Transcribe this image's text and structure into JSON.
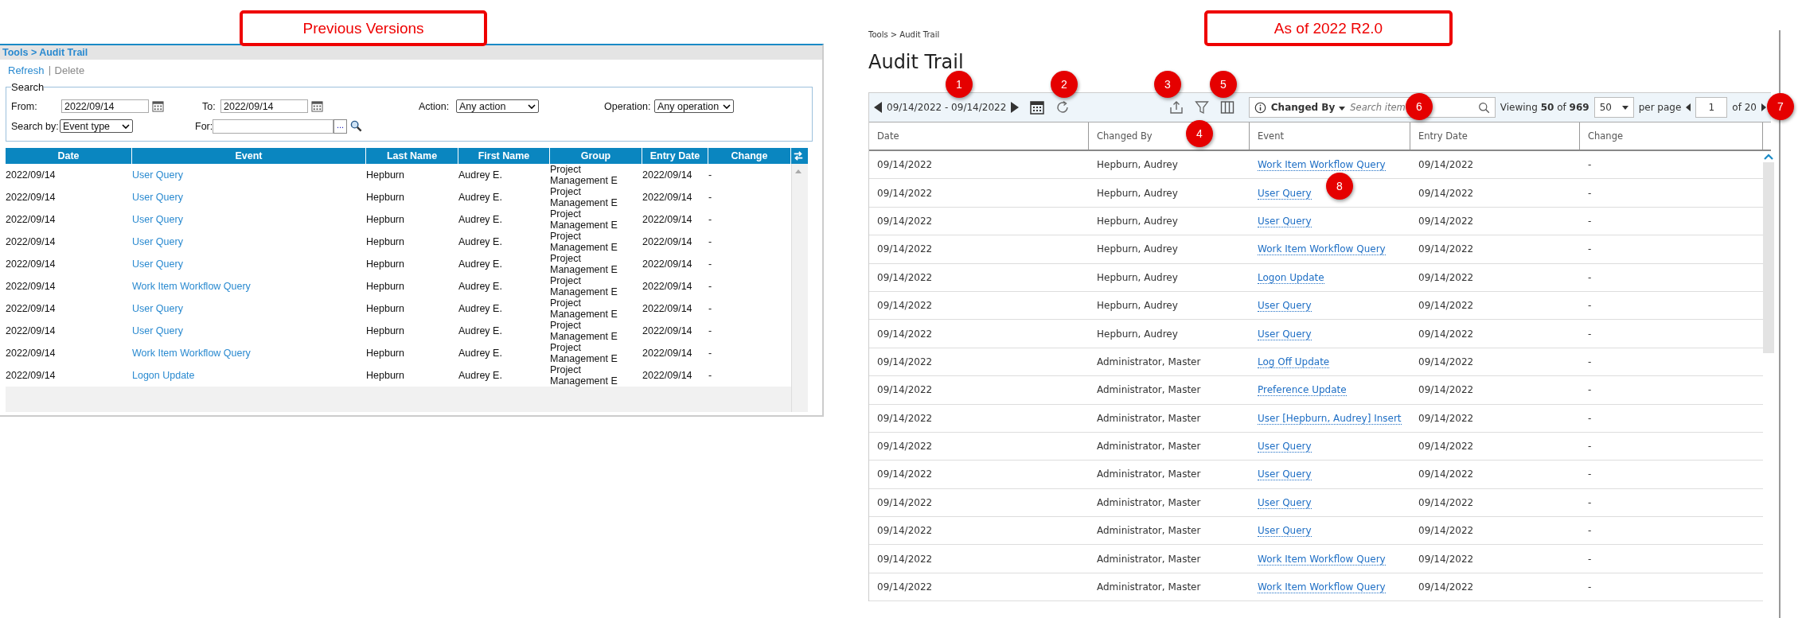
{
  "annotations": [
    {
      "text": "Previous Versions"
    },
    {
      "text": "As of 2022 R2.0"
    }
  ],
  "previous": {
    "breadcrumb": "Tools > Audit Trail",
    "actions": [
      {
        "label": "Refresh",
        "disabled": false
      },
      {
        "label": "Delete",
        "disabled": true
      }
    ],
    "search": {
      "legend": "Search",
      "from_label": "From:",
      "from_value": "2022/09/14",
      "to_label": "To:",
      "to_value": "2022/09/14",
      "action_label": "Action:",
      "action_value": "Any action",
      "operation_label": "Operation:",
      "operation_value": "Any operation",
      "search_by_label": "Search by:",
      "search_by_value": "Event type",
      "for_label": "For:",
      "browse_button": "..."
    },
    "table": {
      "columns": [
        "Date",
        "Event",
        "Last Name",
        "First Name",
        "Group",
        "Entry Date",
        "Change"
      ],
      "rows": [
        [
          "2022/09/14",
          "User Query",
          "Hepburn",
          "Audrey E.",
          "Project Management E",
          "2022/09/14",
          "-"
        ],
        [
          "2022/09/14",
          "User Query",
          "Hepburn",
          "Audrey E.",
          "Project Management E",
          "2022/09/14",
          "-"
        ],
        [
          "2022/09/14",
          "User Query",
          "Hepburn",
          "Audrey E.",
          "Project Management E",
          "2022/09/14",
          "-"
        ],
        [
          "2022/09/14",
          "User Query",
          "Hepburn",
          "Audrey E.",
          "Project Management E",
          "2022/09/14",
          "-"
        ],
        [
          "2022/09/14",
          "User Query",
          "Hepburn",
          "Audrey E.",
          "Project Management E",
          "2022/09/14",
          "-"
        ],
        [
          "2022/09/14",
          "Work Item Workflow Query",
          "Hepburn",
          "Audrey E.",
          "Project Management E",
          "2022/09/14",
          "-"
        ],
        [
          "2022/09/14",
          "User Query",
          "Hepburn",
          "Audrey E.",
          "Project Management E",
          "2022/09/14",
          "-"
        ],
        [
          "2022/09/14",
          "User Query",
          "Hepburn",
          "Audrey E.",
          "Project Management E",
          "2022/09/14",
          "-"
        ],
        [
          "2022/09/14",
          "Work Item Workflow Query",
          "Hepburn",
          "Audrey E.",
          "Project Management E",
          "2022/09/14",
          "-"
        ],
        [
          "2022/09/14",
          "Logon Update",
          "Hepburn",
          "Audrey E.",
          "Project Management E",
          "2022/09/14",
          "-"
        ]
      ]
    }
  },
  "current": {
    "breadcrumb": "Tools > Audit Trail",
    "title": "Audit Trail",
    "toolbar": {
      "date_range": "09/14/2022 - 09/14/2022",
      "search_field": "Changed By",
      "search_placeholder": "Search item",
      "viewing": "Viewing **50** of **969**",
      "page_size": "50",
      "per_page_label": "per page",
      "page": "1",
      "page_total": "of 20"
    },
    "table": {
      "columns": [
        "Date",
        "Changed By",
        "Event",
        "Entry Date",
        "Change"
      ],
      "rows": [
        [
          "09/14/2022",
          "Hepburn, Audrey",
          "Work Item Workflow Query",
          "09/14/2022",
          "-"
        ],
        [
          "09/14/2022",
          "Hepburn, Audrey",
          "User Query",
          "09/14/2022",
          "-"
        ],
        [
          "09/14/2022",
          "Hepburn, Audrey",
          "User Query",
          "09/14/2022",
          "-"
        ],
        [
          "09/14/2022",
          "Hepburn, Audrey",
          "Work Item Workflow Query",
          "09/14/2022",
          "-"
        ],
        [
          "09/14/2022",
          "Hepburn, Audrey",
          "Logon Update",
          "09/14/2022",
          "-"
        ],
        [
          "09/14/2022",
          "Hepburn, Audrey",
          "User Query",
          "09/14/2022",
          "-"
        ],
        [
          "09/14/2022",
          "Hepburn, Audrey",
          "User Query",
          "09/14/2022",
          "-"
        ],
        [
          "09/14/2022",
          "Administrator, Master",
          "Log Off Update",
          "09/14/2022",
          "-"
        ],
        [
          "09/14/2022",
          "Administrator, Master",
          "Preference Update",
          "09/14/2022",
          "-"
        ],
        [
          "09/14/2022",
          "Administrator, Master",
          "User [Hepburn, Audrey] Insert",
          "09/14/2022",
          "-"
        ],
        [
          "09/14/2022",
          "Administrator, Master",
          "User Query",
          "09/14/2022",
          "-"
        ],
        [
          "09/14/2022",
          "Administrator, Master",
          "User Query",
          "09/14/2022",
          "-"
        ],
        [
          "09/14/2022",
          "Administrator, Master",
          "User Query",
          "09/14/2022",
          "-"
        ],
        [
          "09/14/2022",
          "Administrator, Master",
          "User Query",
          "09/14/2022",
          "-"
        ],
        [
          "09/14/2022",
          "Administrator, Master",
          "Work Item Workflow Query",
          "09/14/2022",
          "-"
        ],
        [
          "09/14/2022",
          "Administrator, Master",
          "Work Item Workflow Query",
          "09/14/2022",
          "-"
        ]
      ]
    },
    "callouts": [
      "1",
      "2",
      "3",
      "4",
      "5",
      "6",
      "7",
      "8"
    ]
  }
}
